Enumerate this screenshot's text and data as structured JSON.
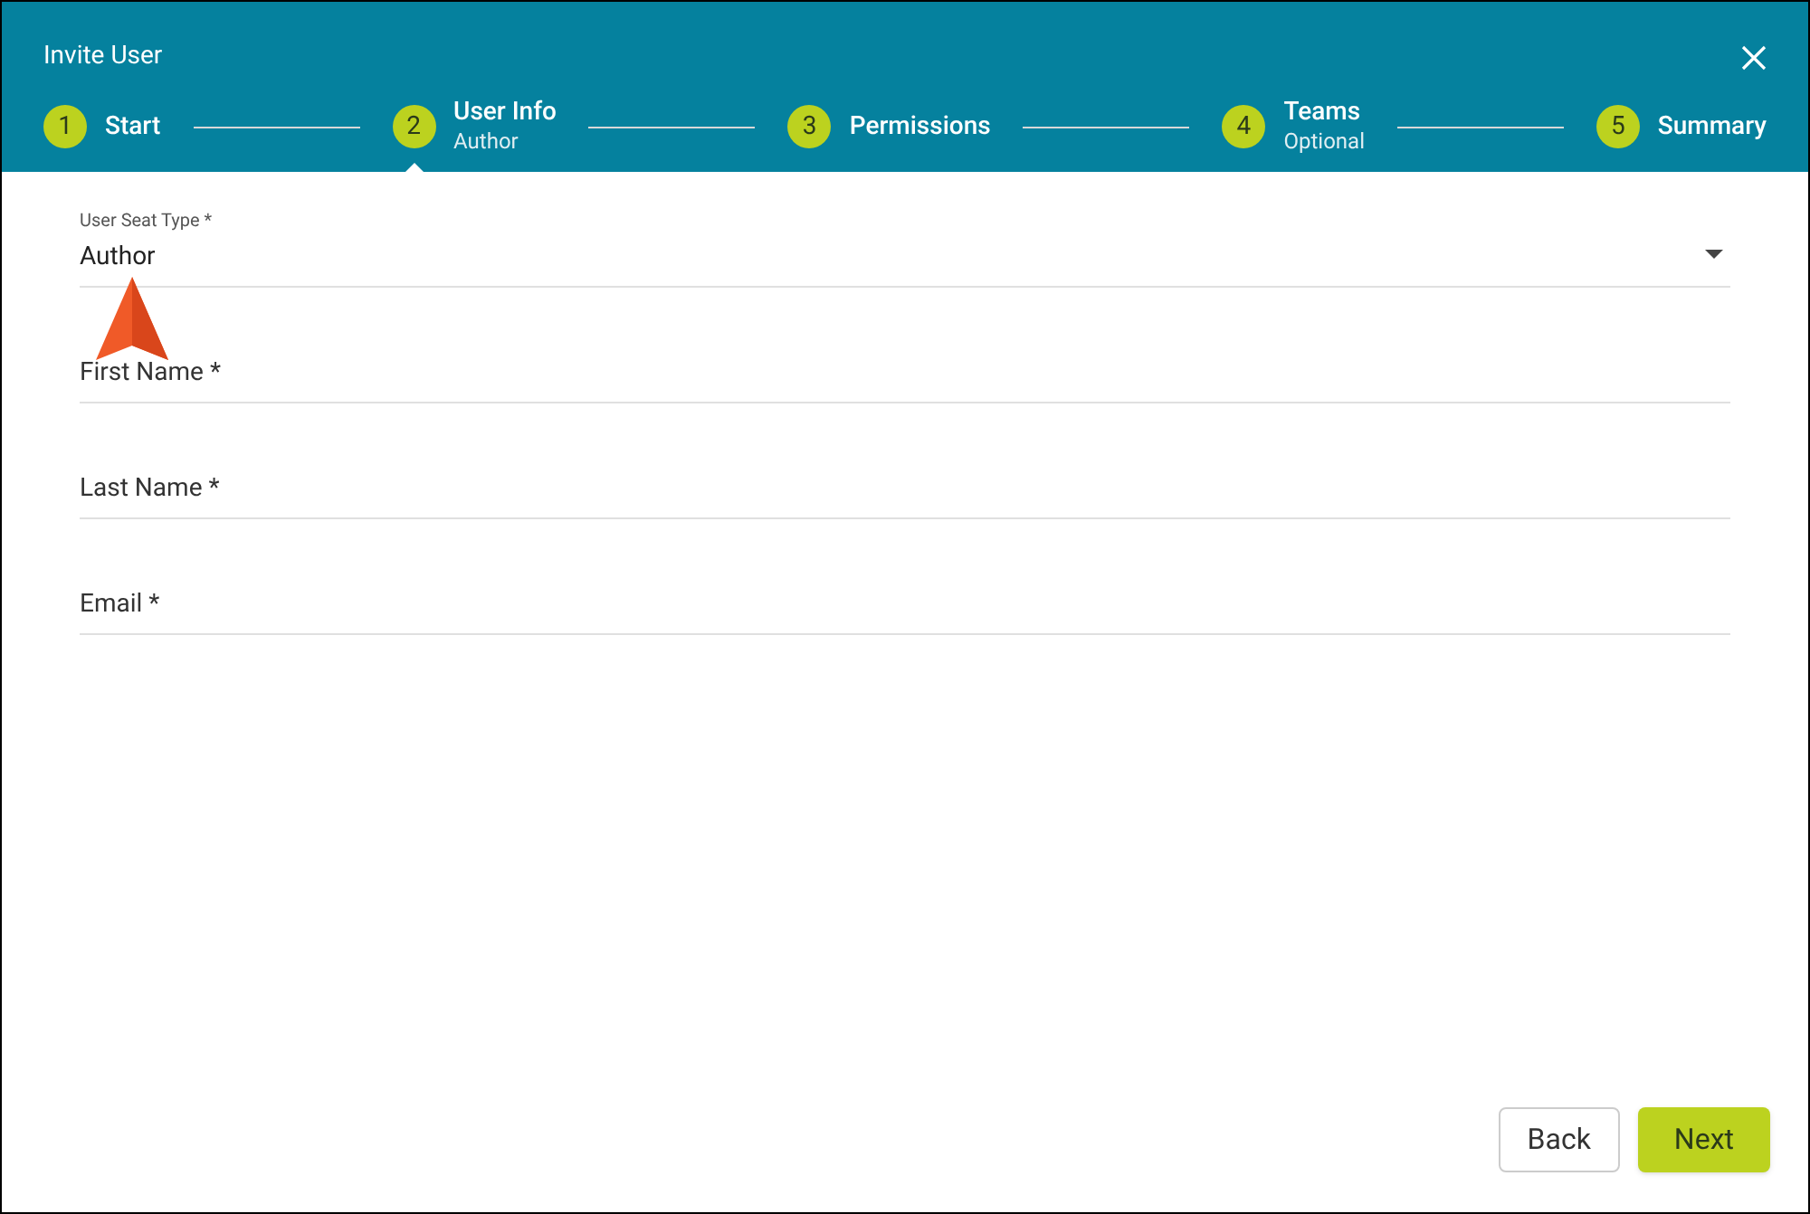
{
  "dialog": {
    "title": "Invite User"
  },
  "steps": [
    {
      "number": "1",
      "label": "Start",
      "selected": false
    },
    {
      "number": "2",
      "label": "User Info",
      "sublabel": "Author",
      "selected": true
    },
    {
      "number": "3",
      "label": "Permissions",
      "selected": false
    },
    {
      "number": "4",
      "label": "Teams",
      "sublabel": "Optional",
      "selected": false
    },
    {
      "number": "5",
      "label": "Summary",
      "selected": false
    }
  ],
  "fields": [
    {
      "kind": "select",
      "label": "User Seat Type *",
      "value": "Author"
    },
    {
      "kind": "text",
      "placeholder": "First Name *"
    },
    {
      "kind": "text",
      "placeholder": "Last Name *"
    },
    {
      "kind": "text",
      "placeholder": "Email *"
    }
  ],
  "buttons": [
    {
      "kind": "secondary",
      "label": "Back"
    },
    {
      "kind": "primary",
      "label": "Next"
    }
  ]
}
